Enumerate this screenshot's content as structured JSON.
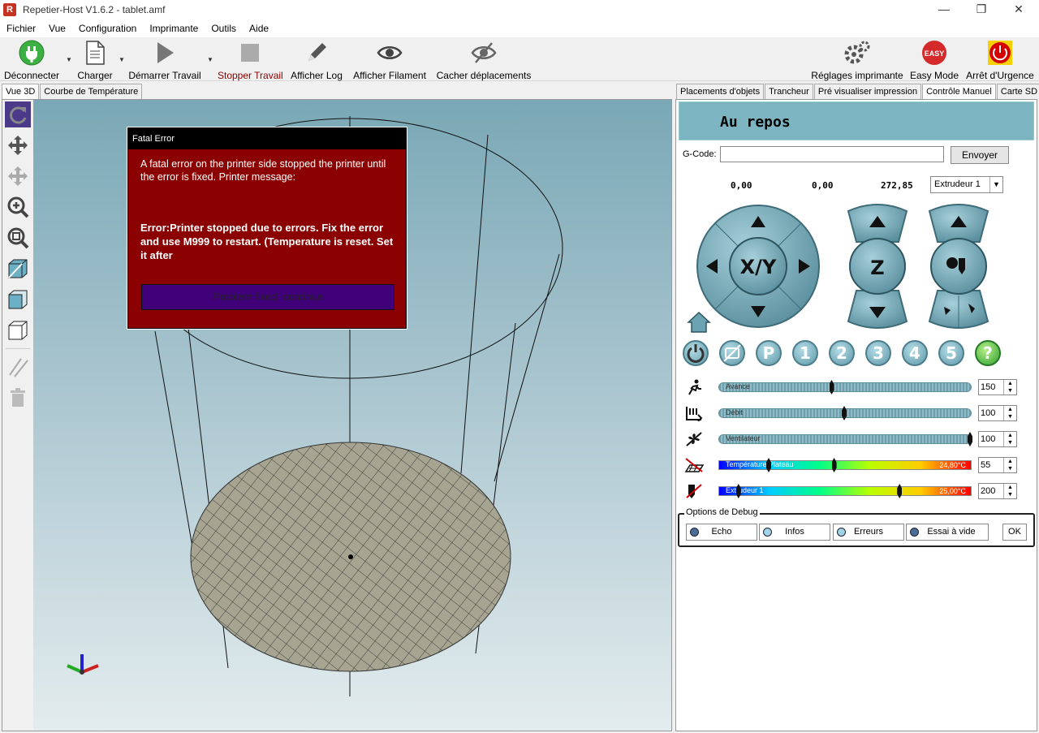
{
  "window": {
    "title": "Repetier-Host V1.6.2 - tablet.amf",
    "app_icon": "R"
  },
  "menu": [
    "Fichier",
    "Vue",
    "Configuration",
    "Imprimante",
    "Outils",
    "Aide"
  ],
  "toolbar": {
    "disconnect": "Déconnecter",
    "load": "Charger",
    "start_job": "Démarrer Travail",
    "stop_job": "Stopper Travail",
    "show_log": "Afficher Log",
    "show_filament": "Afficher Filament",
    "hide_moves": "Cacher  déplacements",
    "printer_settings": "Réglages imprimante",
    "easy_mode": "Easy Mode",
    "easy_badge": "EASY",
    "emergency": "Arrêt d'Urgence"
  },
  "left_tabs": [
    "Vue 3D",
    "Courbe de Température"
  ],
  "right_tabs": [
    "Placements d'objets",
    "Trancheur",
    "Pré visualiser impression",
    "Contrôle Manuel",
    "Carte SD"
  ],
  "status": "Au repos",
  "gcode": {
    "label": "G-Code:",
    "value": "",
    "send": "Envoyer"
  },
  "coords": {
    "x": "0,00",
    "y": "0,00",
    "z": "272,85"
  },
  "extruder_select": "Extrudeur 1",
  "jog": {
    "xy": "X/Y",
    "z": "Z"
  },
  "quick_buttons": [
    "1",
    "2",
    "3",
    "4",
    "5"
  ],
  "quick_letter": "P",
  "quick_help": "?",
  "sliders": [
    {
      "label": "Avance",
      "value": "150",
      "pos": 0.45
    },
    {
      "label": "Débit",
      "value": "100",
      "pos": 0.5
    },
    {
      "label": "Ventilateur",
      "value": "100",
      "pos": 1.0
    }
  ],
  "temps": [
    {
      "label": "Température Plateau",
      "current": "24,80°C",
      "value": "55",
      "pos": 0.46,
      "cur_pos": 0.2
    },
    {
      "label": "Extrudeur 1",
      "current": "25,00°C",
      "value": "200",
      "pos": 0.72,
      "cur_pos": 0.08
    }
  ],
  "debug": {
    "title": "Options de Debug",
    "echo": "Echo",
    "infos": "Infos",
    "errors": "Erreurs",
    "dry_run": "Essai à vide",
    "ok": "OK"
  },
  "fatal": {
    "title": "Fatal Error",
    "intro": "A fatal error on the printer side stopped the printer until the error is fixed. Printer message:",
    "message": "Error:Printer stopped due to errors. Fix the error and use M999 to restart. (Temperature is reset. Set it after",
    "button": "Problem fixed, continue"
  },
  "colors": {
    "accent": "#7db4c2",
    "dialog": "#8b0000",
    "dialog_button": "#40007a"
  }
}
